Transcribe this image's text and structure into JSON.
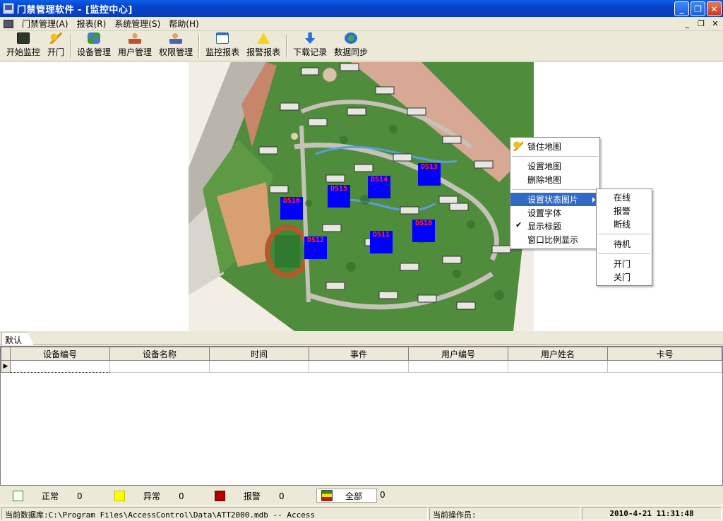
{
  "window": {
    "title": "门禁管理软件 - [监控中心]",
    "controls": [
      "minimize-icon",
      "restore-icon",
      "close-icon"
    ]
  },
  "menubar": {
    "items": [
      "门禁管理(A)",
      "报表(R)",
      "系统管理(S)",
      "帮助(H)"
    ],
    "mdi_controls": [
      "minimize-icon",
      "restore-icon",
      "close-icon"
    ]
  },
  "toolbar": {
    "start_monitor": "开始监控",
    "open_door": "开门",
    "device_mgmt": "设备管理",
    "user_mgmt": "用户管理",
    "perm_mgmt": "权限管理",
    "monitor_report": "监控报表",
    "alarm_report": "报警报表",
    "download_records": "下载记录",
    "data_sync": "数据同步"
  },
  "map": {
    "markers": [
      "DS16",
      "DS15",
      "DS14",
      "DS13",
      "DS12",
      "DS11",
      "DS10"
    ]
  },
  "context_menu": {
    "lock_map": "锁住地图",
    "set_map": "设置地图",
    "delete_map": "删除地图",
    "set_status_image": "设置状态图片",
    "set_font": "设置字体",
    "show_title": "显示标题",
    "show_title_checked": true,
    "window_ratio": "窗口比例显示"
  },
  "submenu": {
    "online": "在线",
    "alarm": "报警",
    "offline": "断线",
    "standby": "待机",
    "door_open": "开门",
    "door_close": "关门"
  },
  "tabs": [
    "默认"
  ],
  "grid": {
    "columns": [
      "设备编号",
      "设备名称",
      "时间",
      "事件",
      "用户编号",
      "用户姓名",
      "卡号"
    ]
  },
  "legend": {
    "normal_label": "正常",
    "normal_count": "0",
    "normal_color": "#ffffff",
    "abnormal_label": "异常",
    "abnormal_count": "0",
    "abnormal_color": "#ffff00",
    "alarm_label": "报警",
    "alarm_count": "0",
    "alarm_color": "#b00000",
    "all_label": "全部",
    "all_count": "0"
  },
  "status": {
    "database": "当前数据库:C:\\Program Files\\AccessControl\\Data\\ATT2000.mdb -- Access",
    "operator": "当前操作员:",
    "datetime": "2010-4-21  11:31:48"
  }
}
